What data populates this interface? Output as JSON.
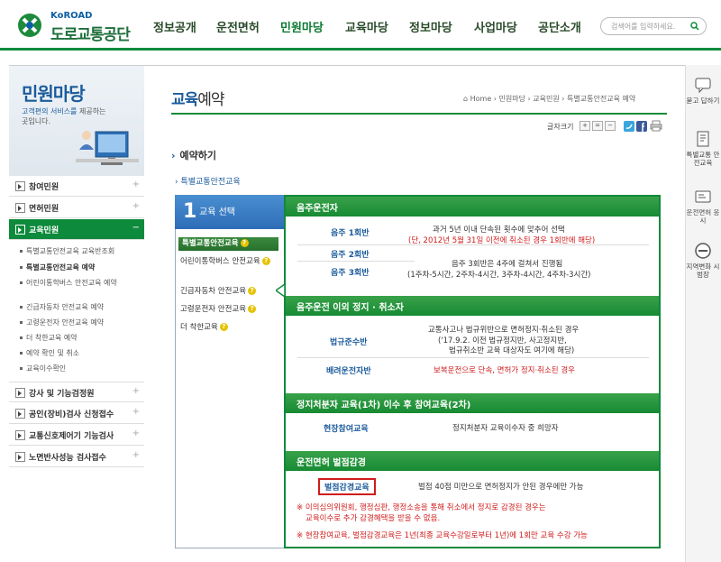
{
  "header": {
    "logo_en": "KoROAD",
    "logo_ko": "도로교통공단",
    "nav": [
      "정보공개",
      "운전면허",
      "민원마당",
      "교육마당",
      "정보마당",
      "사업마당",
      "공단소개"
    ],
    "active_nav": "민원마당",
    "search_placeholder": "검색어를 입력하세요."
  },
  "lnb": {
    "title": "민원마당",
    "desc_hl": "고객편의 서비스를",
    "desc_rest": " 제공하는 곳입니다.",
    "items": [
      {
        "label": "참여민원"
      },
      {
        "label": "면허민원"
      },
      {
        "label": "교육민원"
      }
    ],
    "sub_items": [
      "특별교통안전교육 교육반조회",
      "특별교통안전교육 예약",
      "어린이통학버스 안전교육 예약",
      "긴급자동차 안전교육 예약",
      "고령운전자 안전교육 예약",
      "더 착한교육 예약",
      "예약 확인 및 취소",
      "교육이수확인"
    ],
    "more_items": [
      {
        "label": "강사 및 기능검정원"
      },
      {
        "label": "공인(장비)검사 신청접수"
      },
      {
        "label": "교통신호제어기 기능검사"
      },
      {
        "label": "노면반사성능 검사접수"
      }
    ]
  },
  "content": {
    "title_bold": "교육",
    "title_rest": "예약",
    "breadcrumb": [
      "Home",
      "민원마당",
      "교육민원",
      "특별교통안전교육 예약"
    ],
    "font_size_label": "글자크기",
    "section_title": "예약하기",
    "sub_title": "특별교통안전교육",
    "step_num": "1",
    "step_label": "교육 선택",
    "courses": [
      "특별교통안전교육",
      "어린이통학버스 안전교육",
      "긴급자동차 안전교육",
      "고령운전자 안전교육",
      "더 착한교육"
    ],
    "bands": {
      "b1": "음주운전자",
      "b2": "음주운전 이외 정지 · 취소자",
      "b3": "정지처분자 교육(1차) 이수 후 참여교육(2차)",
      "b4": "운전면허 벌점감경"
    },
    "rows": {
      "r1_label": "음주 1회반",
      "r1_text1": "과거 5년 이내 단속된 횟수에 맞추어 선택",
      "r1_text2": "(단, 2012년 5월 31일 이전에 취소된 경우 1회반에 해당)",
      "r2_label": "음주 2회반",
      "r3_label": "음주 3회반",
      "r3_text1": "음주 3회반은 4주에 걸쳐서 진행됨",
      "r3_text2": "(1주차-5시간, 2주차-4시간, 3주차-4시간, 4주차-3시간)",
      "r4_label": "법규준수반",
      "r4_text1": "교통사고나 법규위반으로 면허정지·취소된 경우",
      "r4_text2": "('17.9.2. 이전 법규정지반, 사고정지반,",
      "r4_text3": "법규취소반 교육 대상자도 여기에 해당)",
      "r5_label": "배려운전자반",
      "r5_text": "보복운전으로 단속, 면허가 정지·취소된 경우",
      "r6_label": "현장참여교육",
      "r6_text": "정지처분자 교육이수자 중 희망자",
      "r7_label": "벌점감경교육",
      "r7_text": "벌점 40점 미만으로 면허정지가 안된 경우에만 가능"
    },
    "notes": {
      "n1a": "※ 이의심의위원회, 행정심판, 행정소송을 통해 취소에서 정지로 감경된 경우는",
      "n1b": "교육이수로 추가 감경혜택을 받을 수 없음.",
      "n2": "※ 현장참여교육, 벌점감경교육은 1년(최종 교육수강일로부터 1년)에 1회만 교육 수강 가능"
    }
  },
  "side_quick": [
    {
      "label": "묻고 답하기",
      "icon": "chat-icon"
    },
    {
      "label": "특별교통 안전교육",
      "icon": "notebook-icon"
    },
    {
      "label": "운전면허 응시",
      "icon": "id-card-icon"
    },
    {
      "label": "지역변화 시범장",
      "icon": "no-entry-icon"
    }
  ],
  "colors": {
    "brand_green": "#0e8a3c",
    "brand_blue": "#1b5b9c",
    "alert_red": "#d01b1b"
  }
}
